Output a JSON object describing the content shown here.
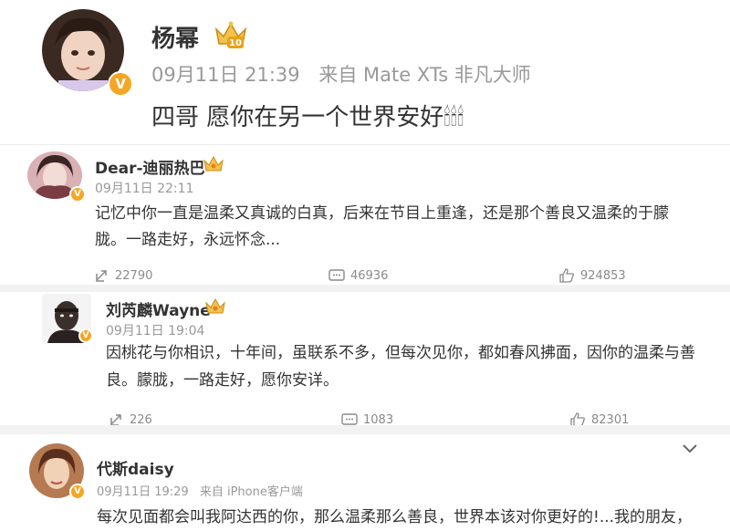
{
  "main_post": {
    "author": "杨幂",
    "timestamp": "09月11日 21:39",
    "source": "来自 Mate XTs 非凡大师",
    "content": "四哥 愿你在另一个世界安好🕯🕯🕯",
    "badge_icon": "gold-crown-level-10-icon",
    "badge_text": "10"
  },
  "comments": [
    {
      "author": "Dear-迪丽热巴",
      "timestamp": "09月11日 22:11",
      "content": "记忆中你一直是温柔又真诚的白真，后来在节目上重逢，还是那个善良又温柔的于朦胧。一路走好，永远怀念...",
      "reposts": "22790",
      "comments": "46936",
      "likes": "924853"
    },
    {
      "author": "刘芮麟Wayne",
      "timestamp": "09月11日 19:04",
      "content": "因桃花与你相识，十年间，虽联系不多，但每次见你，都如春风拂面，因你的温柔与善良。朦胧，一路走好，愿你安详。",
      "reposts": "226",
      "comments": "1083",
      "likes": "82301"
    },
    {
      "author": "代斯daisy",
      "timestamp": "09月11日 19:29",
      "source": "来自 iPhone客户端",
      "content": "每次见面都会叫我阿达西的你，那么温柔那么善良，世界本该对你更好的!...我的朋友，"
    }
  ],
  "colors": {
    "verified_badge": "#f5a623",
    "meta_text": "#999999",
    "divider": "#ececec",
    "gray_band": "#f2f2f2"
  }
}
